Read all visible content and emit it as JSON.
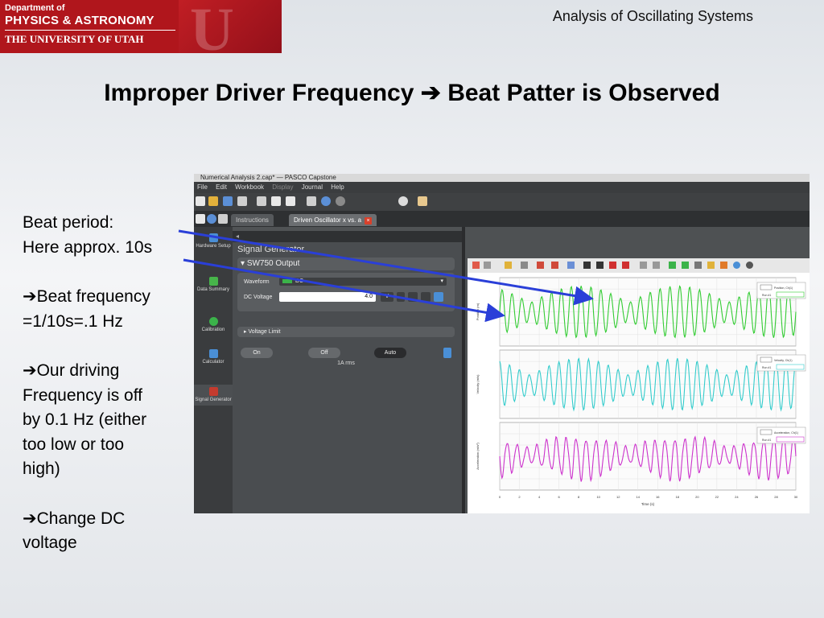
{
  "logo": {
    "line1": "Department of",
    "line2": "PHYSICS & ASTRONOMY",
    "line3": "THE UNIVERSITY OF UTAH"
  },
  "header_text": "Analysis of Oscillating Systems",
  "title": "Improper Driver Frequency ➔ Beat Patter is Observed",
  "bullets": {
    "b1": "Beat period:",
    "b2": "Here approx. 10s",
    "b3": "➔Beat frequency",
    "b4": "=1/10s=.1 Hz",
    "b5": "➔Our driving",
    "b6": "Frequency is off",
    "b7": "by 0.1 Hz (either",
    "b8": "too low or too",
    "b9": "high)",
    "b10": "➔Change DC",
    "b11": "voltage"
  },
  "app": {
    "window_title": "Numerical Analysis 2.cap* — PASCO Capstone",
    "menu": [
      "File",
      "Edit",
      "Workbook",
      "Display",
      "Journal",
      "Help"
    ],
    "tabs": [
      "Instructions",
      "Driven Oscillator x vs. a"
    ],
    "sidebar": [
      "Hardware Setup",
      "Data Summary",
      "Calibration",
      "Calculator",
      "Signal Generator"
    ],
    "panel": {
      "header": "Signal Generator",
      "output": "SW750 Output",
      "waveform_label": "Waveform",
      "waveform_value": "DC",
      "dc_label": "DC Voltage",
      "dc_value": "4.0",
      "dc_unit": "V",
      "limit_label": "Voltage Limit",
      "on": "On",
      "off": "Off",
      "auto": "Auto",
      "rms": "1A rms"
    },
    "graph": {
      "x_axis_label": "Time (s)",
      "x_ticks": [
        "0",
        "2",
        "4",
        "6",
        "8",
        "10",
        "12",
        "14",
        "16",
        "18",
        "20",
        "22",
        "24",
        "26",
        "28",
        "30"
      ],
      "y_labels": [
        "Position (m)",
        "Velocity (m/s)",
        "Acceleration (m/s²)"
      ],
      "legends": [
        "Position, Ch(1)",
        "Velocity, Ch(1)",
        "Acceleration, Ch(1)"
      ],
      "run_label": "Run #1",
      "colors": {
        "position": "#33cc33",
        "velocity": "#33cccc",
        "acceleration": "#cc33cc"
      }
    }
  }
}
